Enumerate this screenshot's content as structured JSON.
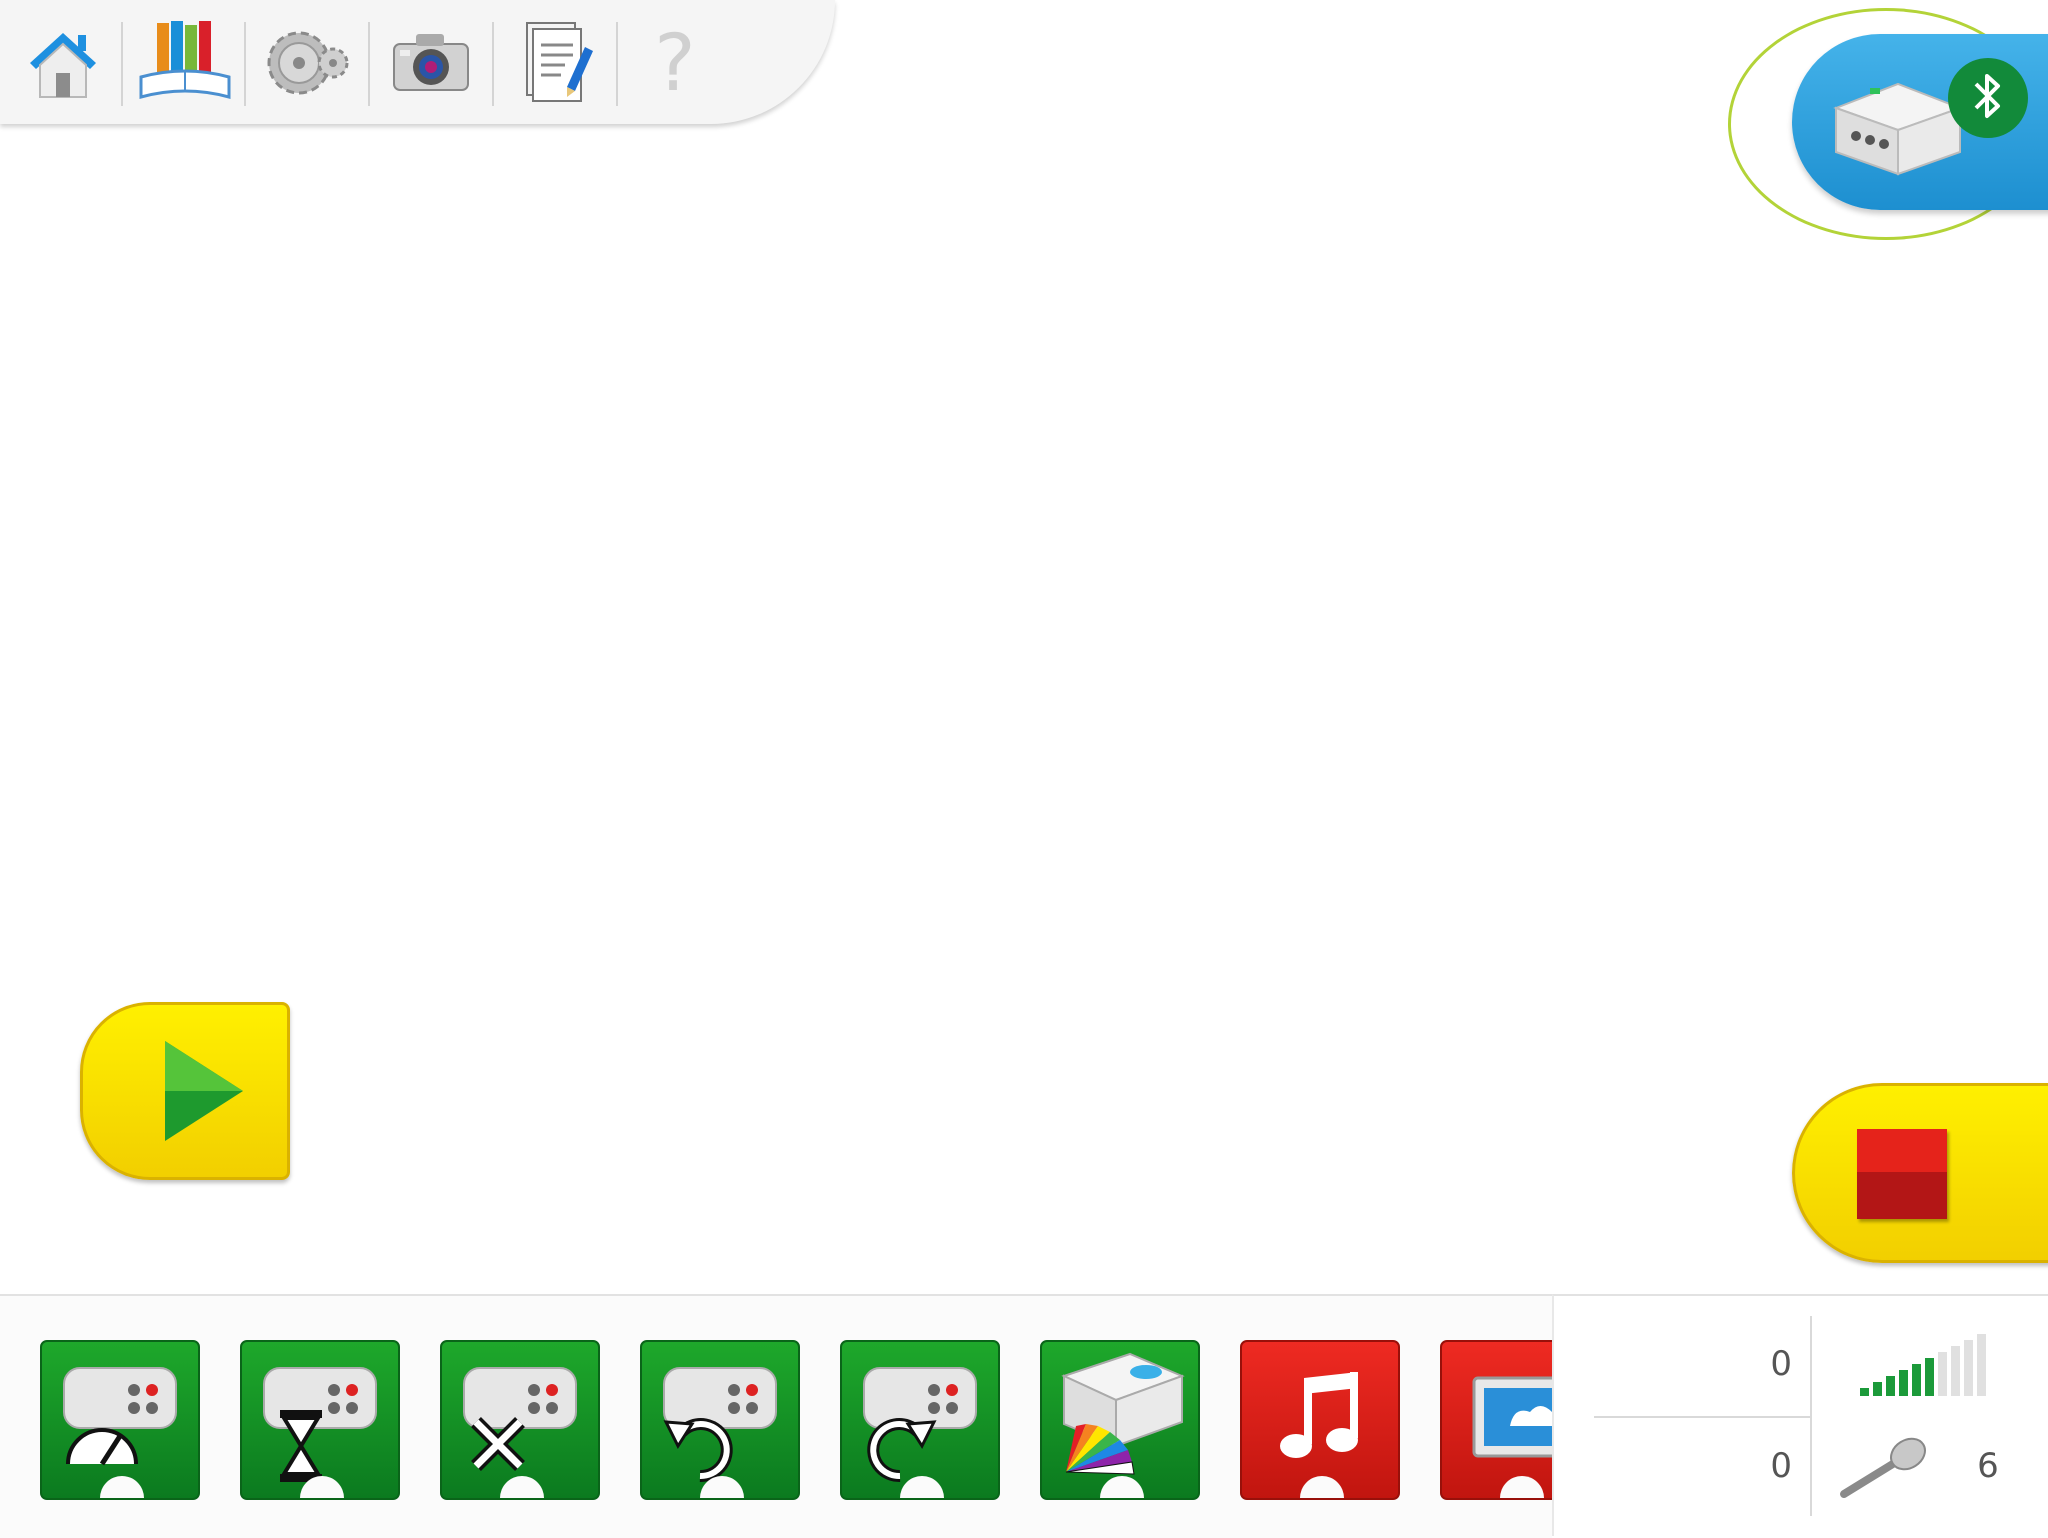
{
  "toolbar": {
    "items": [
      {
        "name": "home-icon"
      },
      {
        "name": "library-icon"
      },
      {
        "name": "gears-icon"
      },
      {
        "name": "camera-icon"
      },
      {
        "name": "document-icon"
      },
      {
        "name": "help-icon",
        "glyph": "?"
      }
    ]
  },
  "hub": {
    "icon": "smarthub-icon",
    "status_icon": "bluetooth-icon",
    "status_color": "#128a3a",
    "highlight_color": "#b3d338"
  },
  "start_block": {
    "icon": "play-icon"
  },
  "stop_block": {
    "icon": "stop-icon"
  },
  "palette": {
    "blocks": [
      {
        "name": "motor-power-block",
        "color": "green",
        "icon": "gauge-icon"
      },
      {
        "name": "motor-time-block",
        "color": "green",
        "icon": "hourglass-icon"
      },
      {
        "name": "motor-stop-block",
        "color": "green",
        "icon": "x-icon"
      },
      {
        "name": "motor-counterclockwise-block",
        "color": "green",
        "icon": "rotate-left-icon"
      },
      {
        "name": "motor-clockwise-block",
        "color": "green",
        "icon": "rotate-right-icon"
      },
      {
        "name": "hub-light-block",
        "color": "green",
        "icon": "color-fan-icon"
      },
      {
        "name": "play-sound-block",
        "color": "red",
        "icon": "music-note-icon"
      },
      {
        "name": "display-block",
        "color": "red",
        "icon": "screen-icon"
      }
    ]
  },
  "sensors": {
    "top_value": "0",
    "bottom_value": "0",
    "sound_level": "6",
    "sound_bars_active": 6,
    "sound_bars_total": 10
  }
}
